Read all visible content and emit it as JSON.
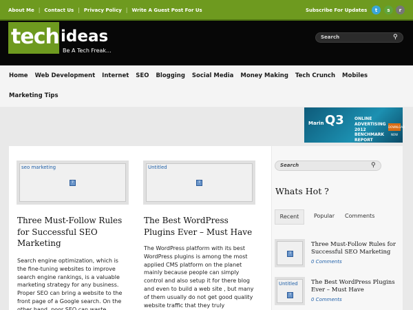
{
  "topbar": {
    "links": [
      "About Me",
      "Contact Us",
      "Privacy Policy",
      "Write A Guest Post For Us"
    ],
    "subscribe": "Subscribe For Updates",
    "social_icons": [
      "twitter-icon",
      "skype-icon",
      "rss-icon"
    ],
    "colors": {
      "bar": "#6e9a1f",
      "twitter": "#3aa6d8",
      "skype": "#5fa53a",
      "rss": "#777777"
    }
  },
  "header": {
    "logo_tech": "tech",
    "logo_ideas": "ideas",
    "tagline": "Be A Tech Freak...",
    "search_placeholder": "Search"
  },
  "nav": {
    "row1": [
      "Home",
      "Web Development",
      "Internet",
      "SEO",
      "Blogging",
      "Social Media",
      "Money Making",
      "Tech Crunch",
      "Mobiles"
    ],
    "row2": [
      "Marketing Tips"
    ]
  },
  "ad": {
    "brand": "Marin",
    "quarter": "Q3",
    "text": "ONLINE ADVERTISING",
    "year": "2012",
    "sub": "BENCHMARK REPORT",
    "button": "DOWNLOAD NOW"
  },
  "posts": [
    {
      "image_alt": "seo marketing",
      "title": "Three Must-Follow Rules for Successful SEO Marketing",
      "excerpt": "Search engine optimization, which is the fine-tuning websites to improve search engine rankings, is a valuable marketing strategy for any business. Proper SEO can bring a website to the front page of a Google search. On the other hand, poor SEO can waste"
    },
    {
      "image_alt": "Untitled",
      "title": "The Best WordPress Plugins Ever – Must Have",
      "excerpt": "The WordPress platform with its best WordPress plugins is among the most applied CMS platform on the planet mainly because people can simply control and also setup it for there blog and even to build a web site , but many of them usually do not get good quality website traffic that they truly"
    }
  ],
  "sidebar": {
    "search_placeholder": "Search",
    "heading": "Whats Hot ?",
    "tabs": [
      "Recent",
      "Popular",
      "Comments"
    ],
    "items": [
      {
        "image_alt": "",
        "title": "Three Must-Follow Rules for Successful SEO Marketing",
        "comments": "0 Comments"
      },
      {
        "image_alt": "Untitled",
        "title": "The Best WordPress Plugins Ever – Must Have",
        "comments": "0 Comments"
      }
    ]
  }
}
